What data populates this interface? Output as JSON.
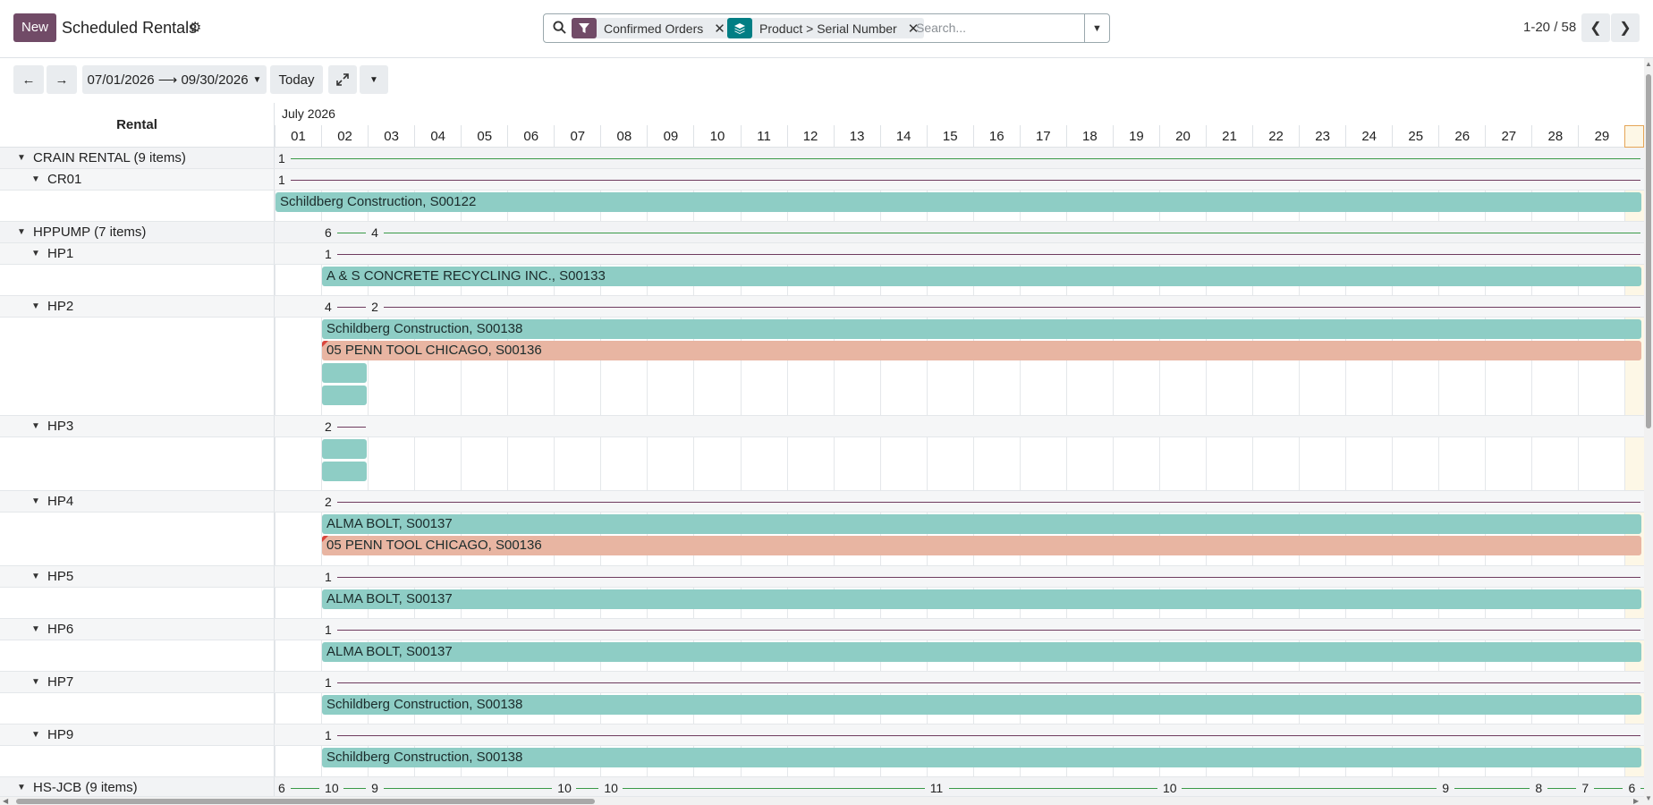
{
  "control_panel": {
    "new_label": "New",
    "title": "Scheduled Rentals",
    "facets": [
      {
        "label": "Confirmed Orders",
        "icon": "filter-icon",
        "color": "#714b67"
      },
      {
        "label": "Product > Serial Number",
        "icon": "layers-icon",
        "color": "#017e84"
      }
    ],
    "search_placeholder": "Search...",
    "pager": "1-20 / 58"
  },
  "toolbar": {
    "prev": "←",
    "next": "→",
    "date_range": "07/01/2026 ⟶ 09/30/2026",
    "today_label": "Today"
  },
  "gantt": {
    "row_header": "Rental",
    "month_label": "July 2026",
    "days": [
      "01",
      "02",
      "03",
      "04",
      "05",
      "06",
      "07",
      "08",
      "09",
      "10",
      "11",
      "12",
      "13",
      "14",
      "15",
      "16",
      "17",
      "18",
      "19",
      "20",
      "21",
      "22",
      "23",
      "24",
      "25",
      "26",
      "27",
      "28",
      "29"
    ],
    "rows": [
      {
        "label": "CRAIN RENTAL (9 items)",
        "level": 0
      },
      {
        "label": "CR01",
        "level": 1
      },
      {
        "label": "",
        "level": 2
      },
      {
        "label": "HPPUMP (7 items)",
        "level": 0
      },
      {
        "label": "HP1",
        "level": 1
      },
      {
        "label": "",
        "level": 2
      },
      {
        "label": "HP2",
        "level": 1
      },
      {
        "label": "",
        "level": 2
      },
      {
        "label": "HP3",
        "level": 1
      },
      {
        "label": "",
        "level": 2
      },
      {
        "label": "HP4",
        "level": 1
      },
      {
        "label": "",
        "level": 2
      },
      {
        "label": "HP5",
        "level": 1
      },
      {
        "label": "",
        "level": 2
      },
      {
        "label": "HP6",
        "level": 1
      },
      {
        "label": "",
        "level": 2
      },
      {
        "label": "HP7",
        "level": 1
      },
      {
        "label": "",
        "level": 2
      },
      {
        "label": "HP9",
        "level": 1
      },
      {
        "label": "",
        "level": 2
      },
      {
        "label": "HS-JCB (9 items)",
        "level": 0
      }
    ],
    "pills": [
      {
        "text": "Schildberg Construction, S00122",
        "color": "teal"
      },
      {
        "text": "A & S CONCRETE RECYCLING INC., S00133",
        "color": "teal"
      },
      {
        "text": "Schildberg Construction, S00138",
        "color": "teal"
      },
      {
        "text": "05 PENN TOOL CHICAGO, S00136",
        "color": "salmon"
      },
      {
        "text": "",
        "color": "teal"
      },
      {
        "text": "",
        "color": "teal"
      },
      {
        "text": "",
        "color": "teal"
      },
      {
        "text": "",
        "color": "teal"
      },
      {
        "text": "ALMA BOLT, S00137",
        "color": "teal"
      },
      {
        "text": "05 PENN TOOL CHICAGO, S00136",
        "color": "salmon"
      },
      {
        "text": "ALMA BOLT, S00137",
        "color": "teal"
      },
      {
        "text": "ALMA BOLT, S00137",
        "color": "teal"
      },
      {
        "text": "Schildberg Construction, S00138",
        "color": "teal"
      },
      {
        "text": "Schildberg Construction, S00138",
        "color": "teal"
      }
    ],
    "counts": {
      "crain": [
        "1"
      ],
      "cr01": [
        "1"
      ],
      "hppump": [
        "6",
        "4"
      ],
      "hp1": [
        "1"
      ],
      "hp2": [
        "4",
        "2"
      ],
      "hp3": [
        "2"
      ],
      "hp4": [
        "2"
      ],
      "hp5": [
        "1"
      ],
      "hp6": [
        "1"
      ],
      "hp7": [
        "1"
      ],
      "hp9": [
        "1"
      ],
      "hsjcb": [
        "6",
        "10",
        "9",
        "10",
        "10",
        "11",
        "10",
        "9",
        "8",
        "7",
        "6"
      ]
    }
  }
}
